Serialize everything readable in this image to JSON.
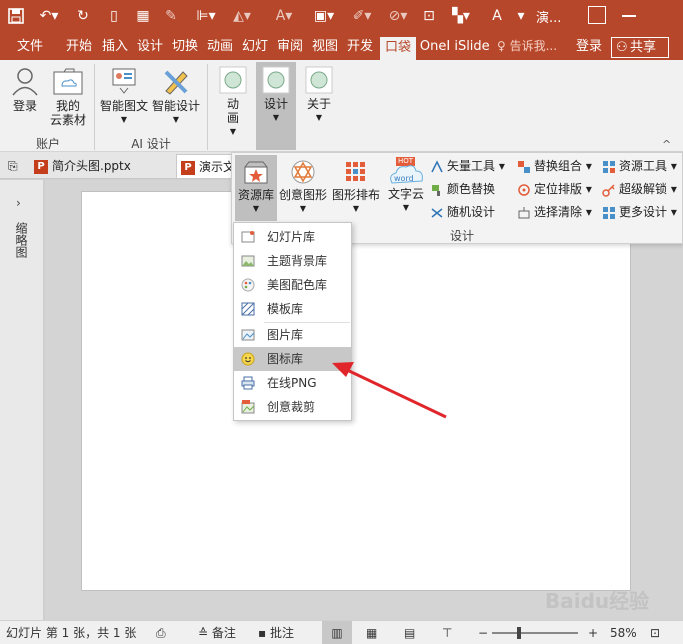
{
  "titlebar": {
    "title": "演...",
    "accent": "#b7472a"
  },
  "tabs": [
    {
      "label": "文件"
    },
    {
      "label": "开始"
    },
    {
      "label": "插入"
    },
    {
      "label": "设计"
    },
    {
      "label": "切换"
    },
    {
      "label": "动画"
    },
    {
      "label": "幻灯"
    },
    {
      "label": "审阅"
    },
    {
      "label": "视图"
    },
    {
      "label": "开发"
    },
    {
      "label": "口袋"
    },
    {
      "label": "OneI"
    },
    {
      "label": "iSlide"
    }
  ],
  "tell_me": "告诉我...",
  "signin": "登录",
  "share": "共享",
  "ribbon": {
    "login": "登录",
    "cloud_line1": "我的",
    "cloud_line2": "云素材",
    "group_account": "账户",
    "smart_diagram": "智能图文",
    "smart_design": "智能设计",
    "group_ai": "AI 设计",
    "anim_line1": "动",
    "anim_line2": "画",
    "design": "设计",
    "about": "关于"
  },
  "doc_tabs": [
    {
      "label": "简介头图.pptx"
    },
    {
      "label": "演示文"
    }
  ],
  "side_panel_label": "缩略图",
  "islide": {
    "resource_lib": "资源库",
    "creative_shape": "创意图形",
    "graphic_layout": "图形排布",
    "word_cloud": "文字云",
    "hot": "HOT",
    "word": "word",
    "vector_tools": "矢量工具",
    "color_replace": "颜色替换",
    "random_design": "随机设计",
    "replace_combo": "替换组合",
    "position_layout": "定位排版",
    "select_clear": "选择清除",
    "resource_tools": "资源工具",
    "super_unlock": "超级解锁",
    "more_design": "更多设计",
    "group_label": "设计"
  },
  "dropdown": {
    "items": [
      {
        "label": "幻灯片库"
      },
      {
        "label": "主题背景库"
      },
      {
        "label": "美图配色库"
      },
      {
        "label": "模板库"
      },
      {
        "label": "图片库"
      },
      {
        "label": "图标库"
      },
      {
        "label": "在线PNG"
      },
      {
        "label": "创意裁剪"
      }
    ],
    "hovered_index": 5
  },
  "status": {
    "slide_info": "幻灯片 第 1 张，共 1 张",
    "notes": "备注",
    "comments": "批注",
    "zoom": "58%",
    "zoom_level": 0.58
  },
  "watermark": "Baidu经验"
}
